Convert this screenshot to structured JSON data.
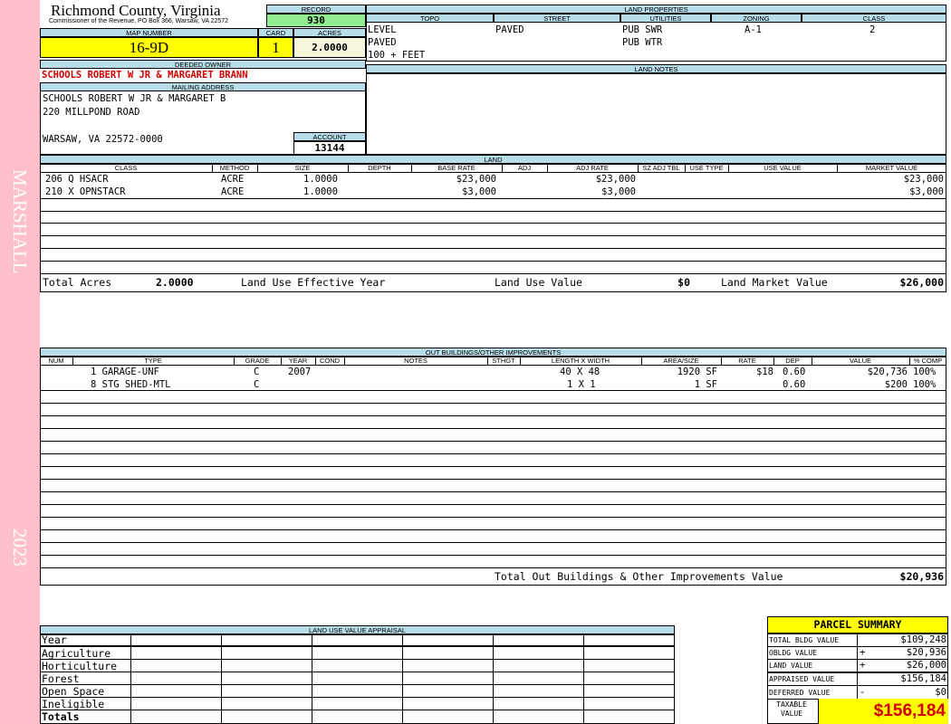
{
  "sidebar": {
    "district": "MARSHALL",
    "year": "2023"
  },
  "header": {
    "county": "Richmond County, Virginia",
    "commissioner": "Commissioner of the Revenue, PO Box 366, Warsaw, VA 22572",
    "record_label": "RECORD",
    "record": "930",
    "map_number_label": "MAP NUMBER",
    "map_number": "16-9D",
    "card_label": "CARD",
    "card": "1",
    "acres_label": "ACRES",
    "acres": "2.0000"
  },
  "owner": {
    "deeded_owner_label": "DEEDED OWNER",
    "deeded_owner": "SCHOOLS ROBERT W JR & MARGARET BRANN",
    "mailing_address_label": "MAILING ADDRESS",
    "address_line1": "SCHOOLS ROBERT W JR & MARGARET B",
    "address_line2": "220 MILLPOND ROAD",
    "address_line3": "WARSAW, VA 22572-0000",
    "account_label": "ACCOUNT",
    "account": "13144"
  },
  "land_properties": {
    "title": "LAND PROPERTIES",
    "headers": {
      "topo": "TOPO",
      "street": "STREET",
      "utilities": "UTILITIES",
      "zoning": "ZONING",
      "class": "CLASS"
    },
    "topo": [
      "LEVEL",
      "PAVED",
      "100 + FEET"
    ],
    "street": "PAVED",
    "utilities": [
      "PUB SWR",
      "PUB WTR"
    ],
    "zoning": "A-1",
    "class": "2"
  },
  "land_notes": {
    "title": "LAND NOTES"
  },
  "land": {
    "title": "LAND",
    "headers": {
      "class": "CLASS",
      "method": "METHOD",
      "size": "SIZE",
      "depth": "DEPTH",
      "base_rate": "BASE RATE",
      "adj": "ADJ",
      "adj_rate": "ADJ RATE",
      "sz_adj_tbl": "SZ ADJ TBL",
      "use_type": "USE TYPE",
      "use_value": "USE VALUE",
      "market_value": "MARKET VALUE"
    },
    "rows": [
      {
        "class": "206 Q HSACR",
        "method": "ACRE",
        "size": "1.0000",
        "base_rate": "$23,000",
        "adj_rate": "$23,000",
        "market_value": "$23,000"
      },
      {
        "class": "210 X OPNSTACR",
        "method": "ACRE",
        "size": "1.0000",
        "base_rate": "$3,000",
        "adj_rate": "$3,000",
        "market_value": "$3,000"
      }
    ],
    "total_acres_label": "Total Acres",
    "total_acres": "2.0000",
    "effective_year_label": "Land Use Effective Year",
    "land_use_value_label": "Land Use Value",
    "land_use_value": "$0",
    "land_market_value_label": "Land Market Value",
    "land_market_value": "$26,000"
  },
  "outbuildings": {
    "title": "OUT BUILDINGS/OTHER IMPROVEMENTS",
    "headers": {
      "num": "NUM",
      "type": "TYPE",
      "grade": "GRADE",
      "year": "YEAR",
      "cond": "COND",
      "notes": "NOTES",
      "sthgt": "STHGT",
      "length_width": "LENGTH X WIDTH",
      "area_size": "AREA/SIZE",
      "rate": "RATE",
      "dep": "DEP",
      "value": "VALUE",
      "pct_comp": "% COMP"
    },
    "rows": [
      {
        "num_type": "1 GARAGE-UNF",
        "grade": "C",
        "year": "2007",
        "length_width": "40 X 48",
        "area_size": "1920 SF",
        "rate": "$18",
        "dep": "0.60",
        "value": "$20,736",
        "pct_comp": "100%"
      },
      {
        "num_type": "8 STG SHED-MTL",
        "grade": "C",
        "year": "",
        "length_width": "1 X 1",
        "area_size": "1 SF",
        "rate": "",
        "dep": "0.60",
        "value": "$200",
        "pct_comp": "100%"
      }
    ],
    "total_label": "Total Out Buildings & Other Improvements Value",
    "total_value": "$20,936"
  },
  "land_use_appraisal": {
    "title": "LAND USE VALUE APPRAISAL",
    "rows": [
      "Year",
      "Agriculture",
      "Horticulture",
      "Forest",
      "Open Space",
      "Ineligible",
      "Totals"
    ]
  },
  "parcel_summary": {
    "title": "PARCEL SUMMARY",
    "rows": [
      {
        "label": "TOTAL BLDG VALUE",
        "sign": "",
        "value": "$109,248"
      },
      {
        "label": "OBLDG VALUE",
        "sign": "+",
        "value": "$20,936"
      },
      {
        "label": "LAND VALUE",
        "sign": "+",
        "value": "$26,000"
      },
      {
        "label": "APPRAISED VALUE",
        "sign": "",
        "value": "$156,184"
      },
      {
        "label": "DEFERRED VALUE",
        "sign": "-",
        "value": "$0"
      }
    ],
    "taxable_label": "TAXABLE VALUE",
    "taxable_value": "$156,184"
  },
  "colors": {
    "sidebar": "#ffc0cb",
    "header_blue": "#b7dde8",
    "yellow": "#ffff00",
    "record_green": "#90ee90",
    "cream": "#f5f5dc",
    "red": "#d00000"
  }
}
